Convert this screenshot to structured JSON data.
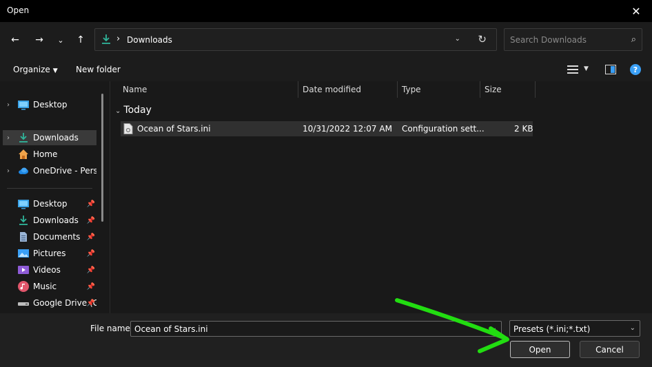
{
  "window": {
    "title": "Open",
    "close_glyph": "✕"
  },
  "navigation": {
    "back_glyph": "←",
    "forward_glyph": "→",
    "recent_glyph": "⌄",
    "up_glyph": "↑",
    "breadcrumb_sep": "›",
    "breadcrumb": "Downloads",
    "refresh_glyph": "↻",
    "address_dropdown_glyph": "⌄",
    "search_placeholder": "Search Downloads",
    "search_glyph": "⌕"
  },
  "command_bar": {
    "organize_label": "Organize",
    "organize_caret": "▼",
    "new_folder_label": "New folder",
    "view_caret": "▼"
  },
  "sidebar": {
    "quick": [
      {
        "label": "Desktop",
        "icon": "desktop-icon"
      },
      {
        "label": "Downloads",
        "icon": "download-icon",
        "selected": true
      },
      {
        "label": "Home",
        "icon": "home-icon"
      },
      {
        "label": "OneDrive - Personal",
        "icon": "cloud-icon"
      }
    ],
    "pinned": [
      {
        "label": "Desktop",
        "icon": "desktop-icon"
      },
      {
        "label": "Downloads",
        "icon": "download-icon"
      },
      {
        "label": "Documents",
        "icon": "document-icon"
      },
      {
        "label": "Pictures",
        "icon": "picture-icon"
      },
      {
        "label": "Videos",
        "icon": "video-icon"
      },
      {
        "label": "Music",
        "icon": "music-icon"
      },
      {
        "label": "Google Drive (G:)",
        "icon": "drive-icon"
      }
    ],
    "chevron_glyph": "›",
    "pin_glyph": "📌"
  },
  "file_list": {
    "columns": [
      "Name",
      "Date modified",
      "Type",
      "Size"
    ],
    "group_label": "Today",
    "group_chevron": "⌄",
    "files": [
      {
        "name": "Ocean of Stars.ini",
        "date": "10/31/2022 12:07 AM",
        "type": "Configuration sett...",
        "size": "2 KB"
      }
    ]
  },
  "footer": {
    "file_name_label": "File name:",
    "file_name_value": "Ocean of Stars.ini",
    "file_name_dropdown_glyph": "⌄",
    "filter_value": "Presets (*.ini;*.txt)",
    "filter_dropdown_glyph": "⌄",
    "open_label": "Open",
    "cancel_label": "Cancel"
  },
  "colors": {
    "accent_blue": "#3a9ff5",
    "download_green": "#2fb59a",
    "annotation_green": "#22dd11"
  }
}
